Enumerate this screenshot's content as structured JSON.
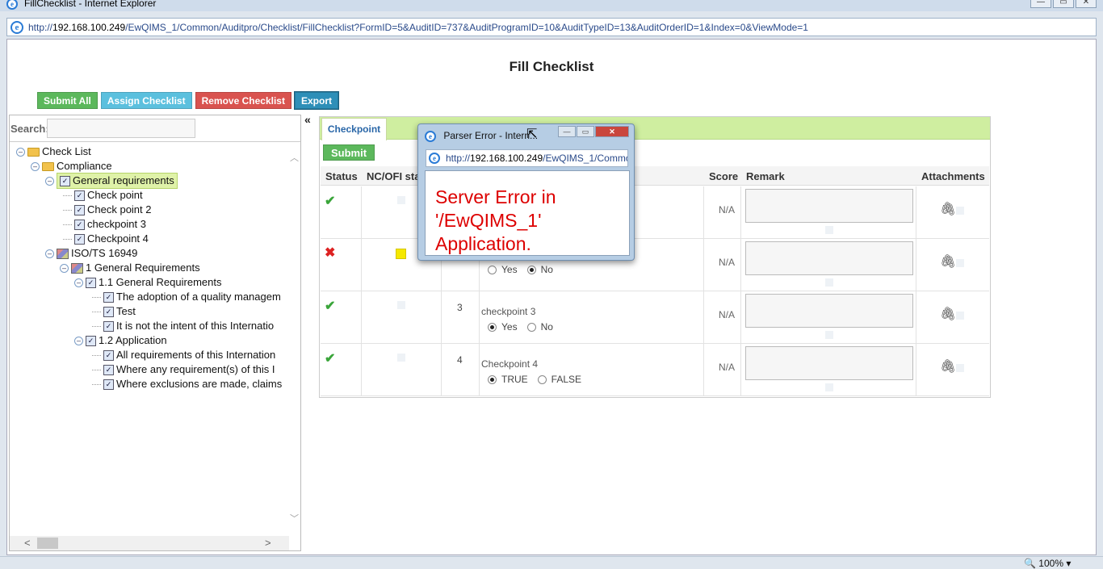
{
  "window": {
    "title": "FillChecklist - Internet Explorer",
    "url_prefix": "http://",
    "url_host": "192.168.100.249",
    "url_path": "/EwQIMS_1/Common/Auditpro/Checklist/FillChecklist?FormID=5&AuditID=737&AuditProgramID=10&AuditTypeID=13&AuditOrderID=1&Index=0&ViewMode=1",
    "zoom": "100%"
  },
  "page": {
    "title": "Fill Checklist",
    "buttons": {
      "submit_all": "Submit All",
      "assign": "Assign Checklist",
      "remove": "Remove Checklist",
      "export": "Export"
    }
  },
  "search": {
    "label": "Search:"
  },
  "tree": [
    {
      "label": "Check List"
    },
    {
      "label": "Compliance"
    },
    {
      "label": "General requirements"
    },
    {
      "label": "Check point"
    },
    {
      "label": "Check point 2"
    },
    {
      "label": "checkpoint 3"
    },
    {
      "label": "Checkpoint 4"
    },
    {
      "label": "ISO/TS 16949"
    },
    {
      "label": "1 General Requirements"
    },
    {
      "label": "1.1 General Requirements"
    },
    {
      "label": "The adoption of a quality managem"
    },
    {
      "label": "Test"
    },
    {
      "label": "It is not the intent of this Internatio"
    },
    {
      "label": "1.2 Application"
    },
    {
      "label": "All requirements of this Internation"
    },
    {
      "label": "Where any requirement(s) of this I"
    },
    {
      "label": "Where exclusions are made, claims"
    }
  ],
  "panel": {
    "collapse": "«",
    "tab": "Checkpoint",
    "submit": "Submit",
    "headers": {
      "status": "Status",
      "ncofi": "NC/OFI sta",
      "score": "Score",
      "remark": "Remark",
      "attachments": "Attachments"
    },
    "rows": [
      {
        "status": "pass",
        "ord": "",
        "name": "",
        "opt_a": "",
        "opt_b": "",
        "score": "N/A"
      },
      {
        "status": "fail",
        "ord": "",
        "name": "",
        "opt_a": "Yes",
        "opt_b": "No",
        "selected": "b",
        "score": "N/A"
      },
      {
        "status": "pass",
        "ord": "3",
        "name": "checkpoint 3",
        "opt_a": "Yes",
        "opt_b": "No",
        "selected": "a",
        "score": "N/A"
      },
      {
        "status": "pass",
        "ord": "4",
        "name": "Checkpoint 4",
        "opt_a": "TRUE",
        "opt_b": "FALSE",
        "selected": "a",
        "score": "N/A"
      }
    ]
  },
  "popup": {
    "title": "Parser Error - Intern...",
    "url_prefix": "http://",
    "url_host": "192.168.100.249",
    "url_path": "/EwQIMS_1/Commo",
    "error_line1": "Server Error in",
    "error_line2": "'/EwQIMS_1'",
    "error_line3": "Application."
  },
  "colors": {
    "pass": "#3aa53a",
    "fail": "#dd2222",
    "error_text": "#dd0000",
    "tab_strip": "#cfeea0"
  }
}
